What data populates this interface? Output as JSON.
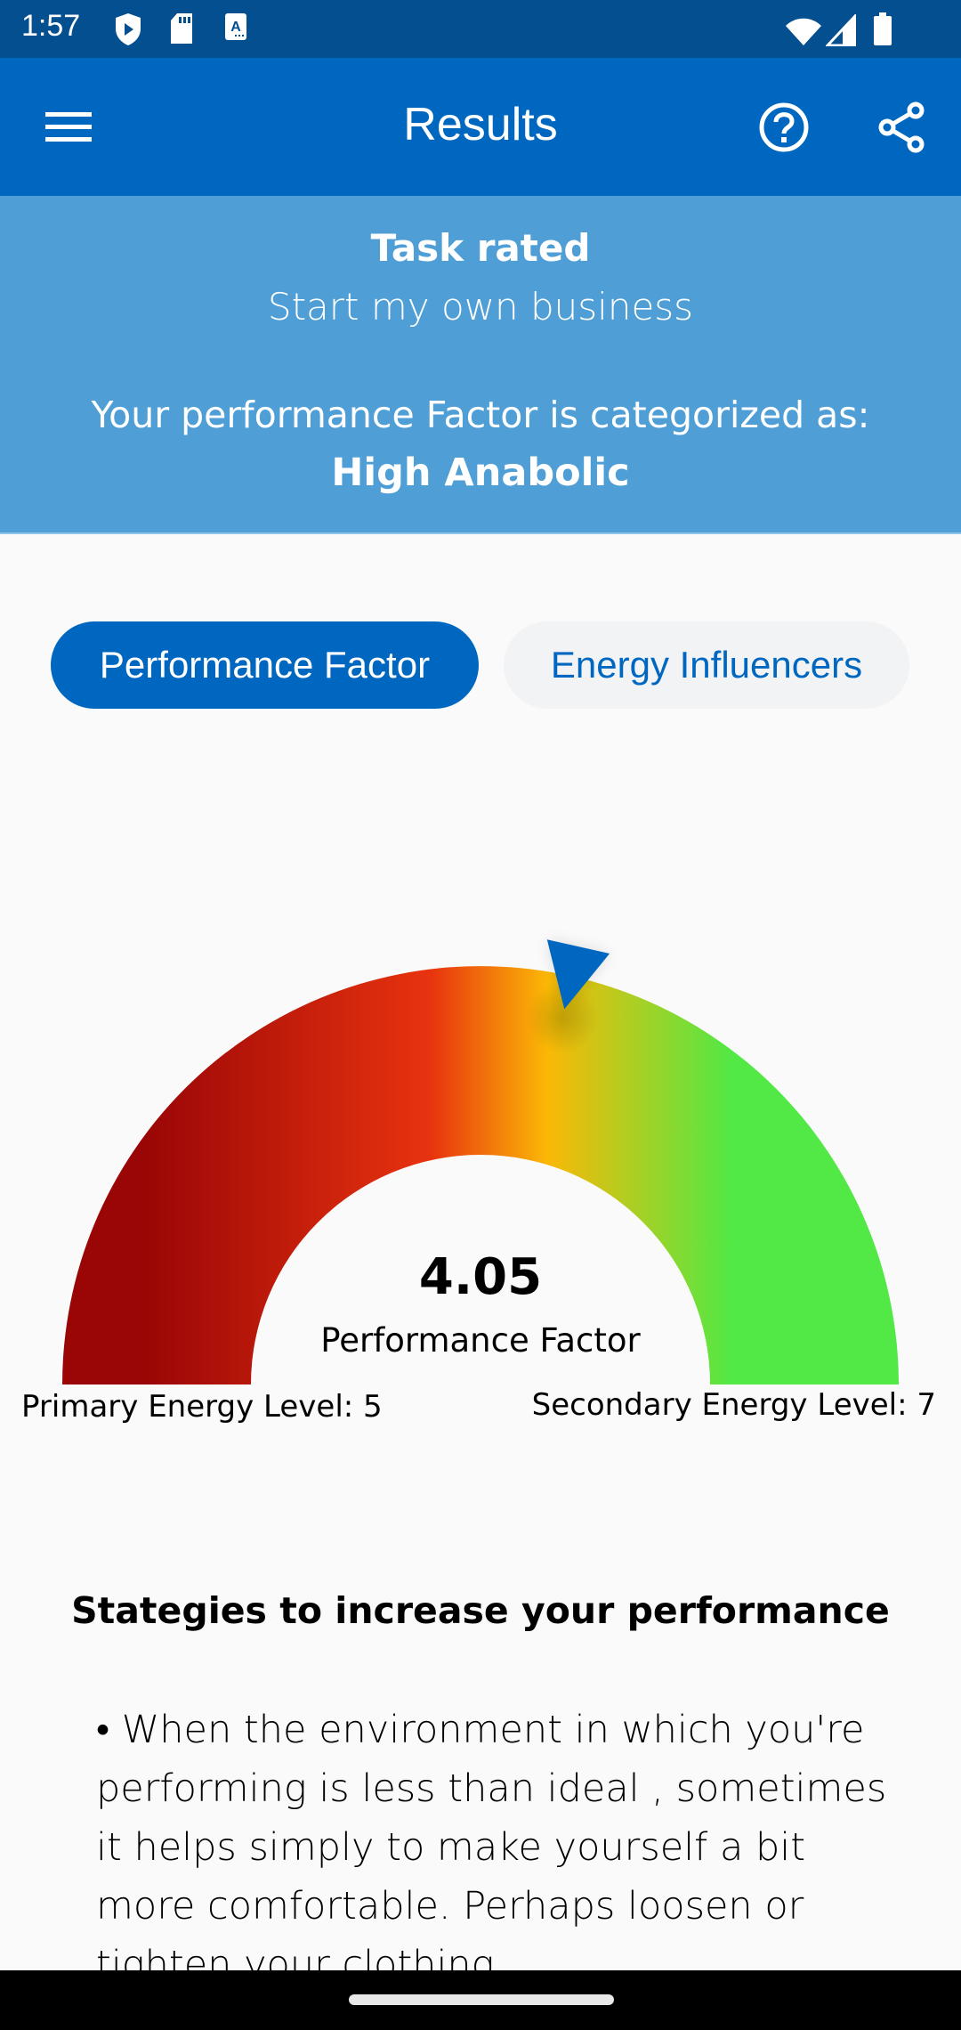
{
  "status_bar": {
    "time": "1:57",
    "left_icons": [
      "play-shield-icon",
      "sd-card-icon",
      "accessibility-a-icon"
    ],
    "right_icons": [
      "wifi-icon",
      "cell-signal-icon",
      "battery-icon"
    ]
  },
  "toolbar": {
    "title": "Results",
    "menu_icon": "hamburger-menu-icon",
    "help_icon": "help-circle-icon",
    "share_icon": "share-icon"
  },
  "banner": {
    "task_label": "Task rated",
    "task_name": "Start my own business",
    "category_label": "Your performance Factor is categorized as:",
    "category_value": "High Anabolic"
  },
  "tabs": [
    {
      "label": "Performance Factor",
      "active": true
    },
    {
      "label": "Energy Influencers",
      "active": false
    }
  ],
  "gauge": {
    "value": "4.05",
    "value_label": "Performance Factor",
    "pointer_fraction": 0.57,
    "primary_energy": "Primary Energy Level: 5",
    "secondary_energy": "Secondary Energy Level: 7",
    "gradient_colors": [
      "#9a0606",
      "#e8330f",
      "#fbb806",
      "#52e845"
    ],
    "pointer_color": "#0067c0"
  },
  "strategies": {
    "title": "Stategies to increase your performance",
    "text": "• When the environment in which you're performing is less than ideal , sometimes it helps simply to make yourself a bit more comfortable. Perhaps loosen or tighten your clothing"
  },
  "colors": {
    "status_bar": "#034f8f",
    "toolbar": "#0067c0",
    "banner": "#4f9fd6",
    "accent": "#0067c0"
  }
}
